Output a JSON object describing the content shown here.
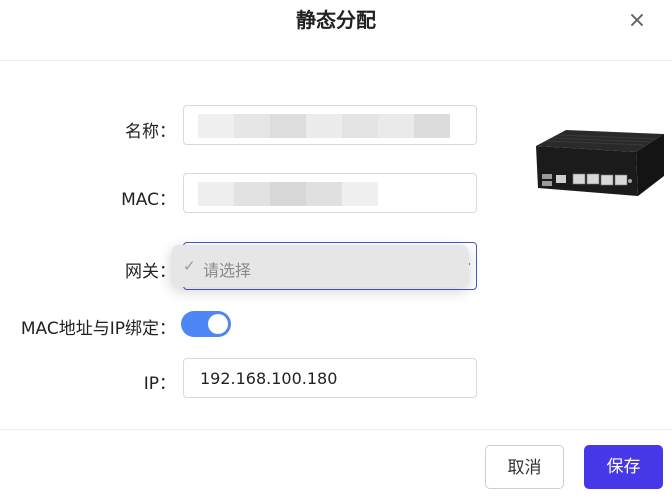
{
  "dialog": {
    "title": "静态分配"
  },
  "form": {
    "name_label": "名称：",
    "mac_label": "MAC：",
    "gateway_label": "网关：",
    "gateway_placeholder": "请选择",
    "binding_label": "MAC地址与IP绑定：",
    "binding_enabled": true,
    "ip_label": "IP：",
    "ip_value": "192.168.100.180"
  },
  "footer": {
    "cancel_label": "取消",
    "save_label": "保存"
  },
  "colors": {
    "accent": "#4637e8",
    "toggle": "#4f86f7",
    "focus_border": "#4b57c9"
  },
  "icons": {
    "close": "close-icon",
    "check": "check-icon",
    "dropdown": "chevron-down-icon"
  }
}
